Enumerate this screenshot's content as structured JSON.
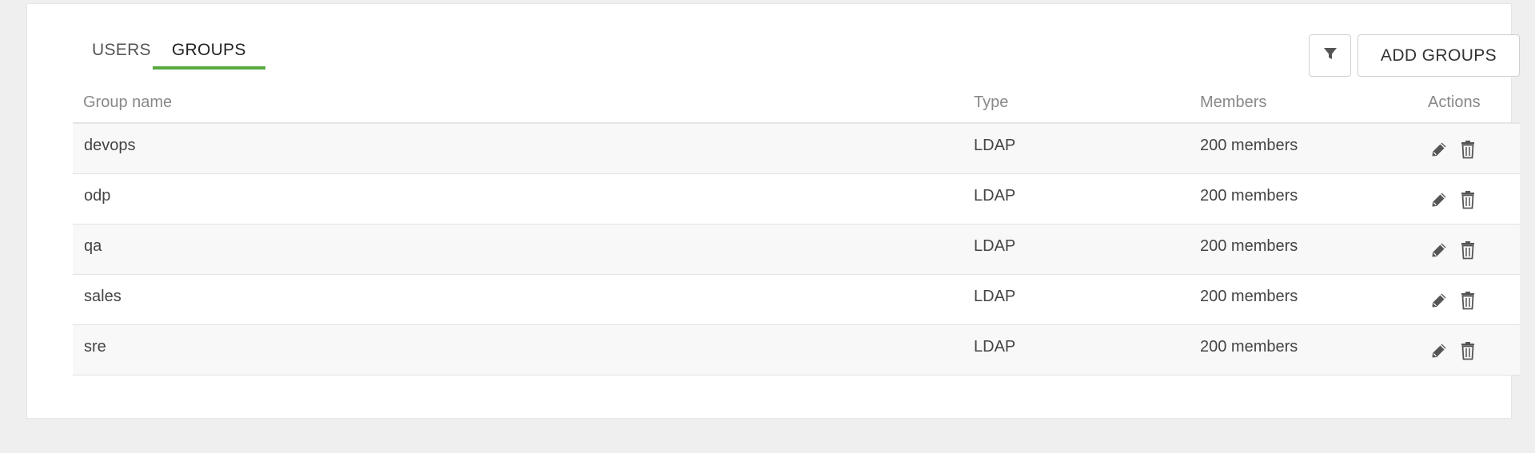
{
  "tabs": [
    {
      "label": "USERS",
      "active": false
    },
    {
      "label": "GROUPS",
      "active": true
    }
  ],
  "toolbar": {
    "filter_icon": "filter-icon",
    "add_label": "ADD GROUPS"
  },
  "table": {
    "headers": {
      "name": "Group name",
      "type": "Type",
      "members": "Members",
      "actions": "Actions"
    },
    "rows": [
      {
        "name": "devops",
        "type": "LDAP",
        "members": "200 members"
      },
      {
        "name": "odp",
        "type": "LDAP",
        "members": "200 members"
      },
      {
        "name": "qa",
        "type": "LDAP",
        "members": "200 members"
      },
      {
        "name": "sales",
        "type": "LDAP",
        "members": "200 members"
      },
      {
        "name": "sre",
        "type": "LDAP",
        "members": "200 members"
      }
    ],
    "row_icons": [
      "pencil-icon",
      "trash-icon"
    ]
  },
  "colors": {
    "accent": "#59aa3f",
    "page_bg": "#efefef"
  }
}
